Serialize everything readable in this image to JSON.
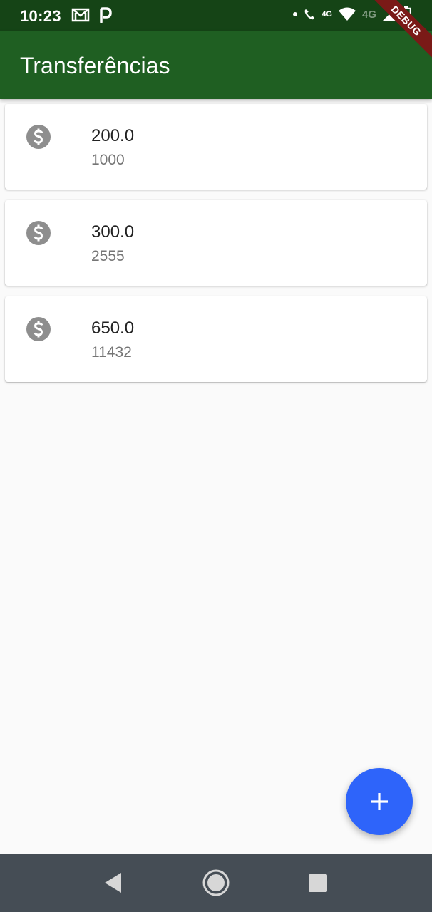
{
  "status_bar": {
    "time": "10:23",
    "network_primary": "4G",
    "network_secondary": "4G",
    "icons": [
      "gmail-icon",
      "parking-app-icon",
      "wifi-calling-icon",
      "wifi-icon",
      "signal-icon",
      "battery-charging-icon"
    ]
  },
  "debug_banner": "DEBUG",
  "app_bar": {
    "title": "Transferências"
  },
  "transfers": [
    {
      "value": "200.0",
      "account": "1000",
      "icon": "monetization-icon"
    },
    {
      "value": "300.0",
      "account": "2555",
      "icon": "monetization-icon"
    },
    {
      "value": "650.0",
      "account": "11432",
      "icon": "monetization-icon"
    }
  ],
  "fab": {
    "icon": "add-icon"
  },
  "nav_bar": {
    "buttons": [
      "back-icon",
      "home-icon",
      "recents-icon"
    ]
  },
  "colors": {
    "status_bar": "#154416",
    "app_bar": "#1f5f22",
    "fab": "#2e64fa",
    "nav_bar": "#454d55",
    "icon_grey": "#8e8e8e"
  }
}
